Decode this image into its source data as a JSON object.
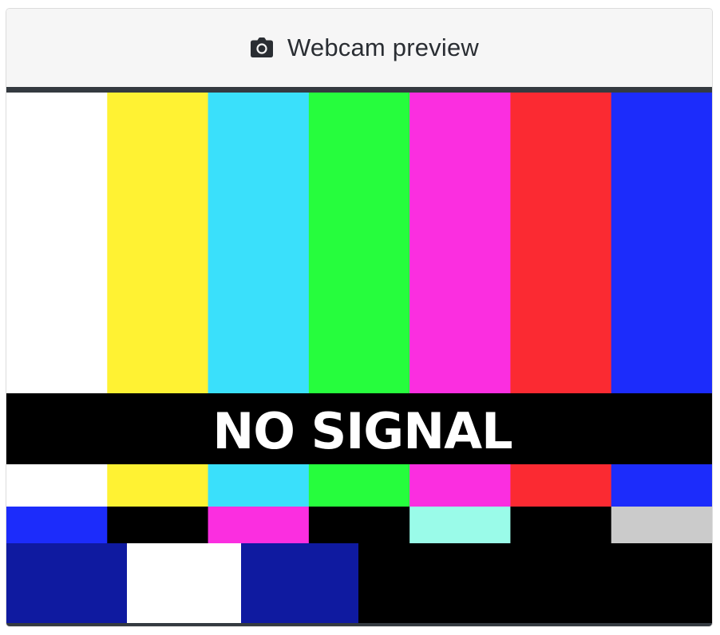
{
  "header": {
    "title": "Webcam preview",
    "icon": "camera-icon"
  },
  "preview": {
    "overlay_text": "NO SIGNAL",
    "top_bars": [
      "#ffffff",
      "#fff233",
      "#3ae0fb",
      "#26fd3d",
      "#fb2ee0",
      "#fb2a32",
      "#1c2cfb"
    ],
    "middle_bars": [
      "#1c2cfb",
      "#000000",
      "#fb2ee0",
      "#000000",
      "#9afbe9",
      "#000000",
      "#cbcbcb"
    ],
    "bottom_blocks": [
      "#0f1aa0",
      "#ffffff",
      "#0f1aa0",
      "#000000"
    ],
    "band_color": "#000000",
    "frame_color": "#343a40"
  }
}
